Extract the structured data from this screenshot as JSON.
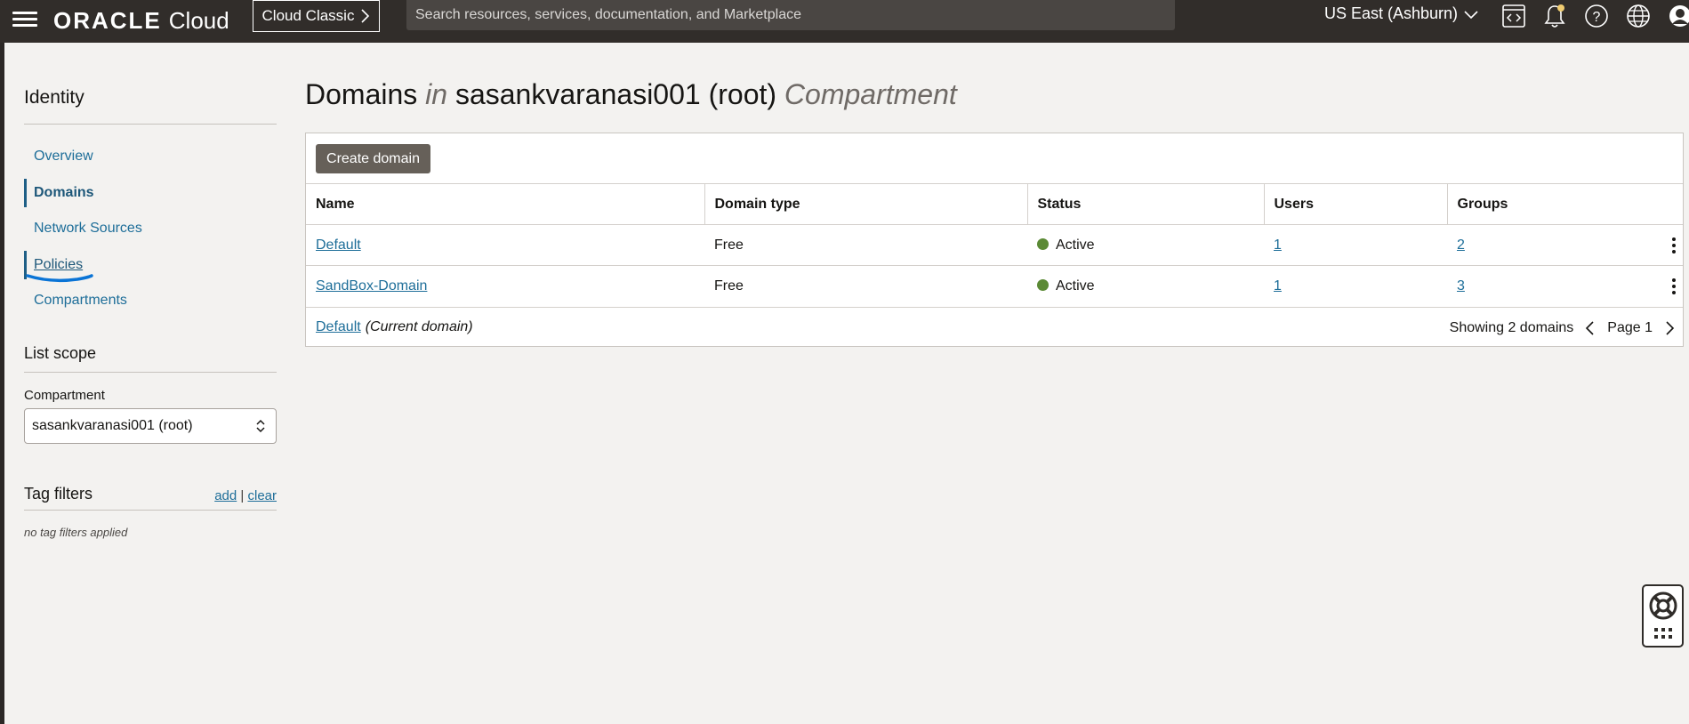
{
  "topbar": {
    "brand": "ORACLE",
    "product": "Cloud",
    "classic_label": "Cloud Classic",
    "search_placeholder": "Search resources, services, documentation, and Marketplace",
    "region": "US East (Ashburn)",
    "icons": [
      "menu-icon",
      "code-editor-icon",
      "notification-bell-icon",
      "help-icon",
      "globe-icon",
      "profile-icon"
    ]
  },
  "sidebar": {
    "title": "Identity",
    "items": [
      {
        "label": "Overview"
      },
      {
        "label": "Domains"
      },
      {
        "label": "Network Sources"
      },
      {
        "label": "Policies"
      },
      {
        "label": "Compartments"
      }
    ],
    "list_scope_title": "List scope",
    "compartment_label": "Compartment",
    "compartment_value": "sasankvaranasi001 (root)",
    "tag_filters_title": "Tag filters",
    "tag_add": "add",
    "tag_sep": "|",
    "tag_clear": "clear",
    "no_tags": "no tag filters applied"
  },
  "main": {
    "title_prefix": "Domains",
    "title_in": "in",
    "title_compartment": "sasankvaranasi001 (root)",
    "title_suffix": "Compartment",
    "create_button": "Create domain",
    "columns": [
      "Name",
      "Domain type",
      "Status",
      "Users",
      "Groups"
    ],
    "rows": [
      {
        "name": "Default",
        "type": "Free",
        "status": "Active",
        "users": "1",
        "groups": "2"
      },
      {
        "name": "SandBox-Domain",
        "type": "Free",
        "status": "Active",
        "users": "1",
        "groups": "3"
      }
    ],
    "footer_domain": "Default",
    "footer_current": "(Current domain)",
    "showing": "Showing 2 domains",
    "page": "Page 1"
  },
  "colors": {
    "topbar": "#312d2a",
    "link": "#1e6e99",
    "active_status": "#5b8a35",
    "primary_button": "#666059"
  }
}
